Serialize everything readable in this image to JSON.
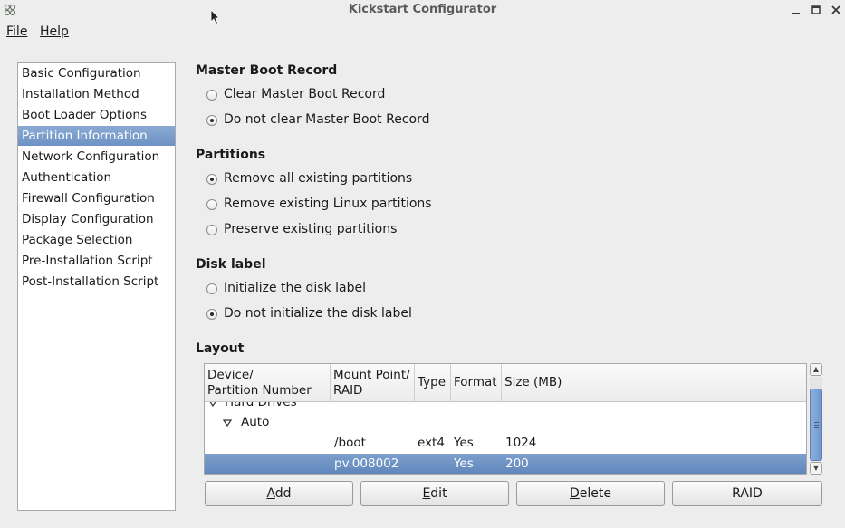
{
  "window": {
    "title": "Kickstart Configurator"
  },
  "menu": {
    "file": "File",
    "help": "Help"
  },
  "sidebar": {
    "items": [
      {
        "label": "Basic Configuration",
        "selected": false
      },
      {
        "label": "Installation Method",
        "selected": false
      },
      {
        "label": "Boot Loader Options",
        "selected": false
      },
      {
        "label": "Partition Information",
        "selected": true
      },
      {
        "label": "Network Configuration",
        "selected": false
      },
      {
        "label": "Authentication",
        "selected": false
      },
      {
        "label": "Firewall Configuration",
        "selected": false
      },
      {
        "label": "Display Configuration",
        "selected": false
      },
      {
        "label": "Package Selection",
        "selected": false
      },
      {
        "label": "Pre-Installation Script",
        "selected": false
      },
      {
        "label": "Post-Installation Script",
        "selected": false
      }
    ]
  },
  "mbr": {
    "title": "Master Boot Record",
    "options": [
      {
        "label": "Clear Master Boot Record",
        "checked": false
      },
      {
        "label": "Do not clear Master Boot Record",
        "checked": true
      }
    ]
  },
  "partitions": {
    "title": "Partitions",
    "options": [
      {
        "label": "Remove all existing partitions",
        "checked": true
      },
      {
        "label": "Remove existing Linux partitions",
        "checked": false
      },
      {
        "label": "Preserve existing partitions",
        "checked": false
      }
    ]
  },
  "disk_label": {
    "title": "Disk label",
    "options": [
      {
        "label": "Initialize the disk label",
        "checked": false
      },
      {
        "label": "Do not initialize the disk label",
        "checked": true
      }
    ]
  },
  "layout": {
    "title": "Layout",
    "columns": {
      "device_1": "Device/",
      "device_2": "Partition Number",
      "mount_1": "Mount Point/",
      "mount_2": "RAID",
      "type": "Type",
      "format": "Format",
      "size": "Size (MB)"
    },
    "rows": {
      "hard_drives": "Hard Drives",
      "auto": "Auto",
      "boot": {
        "mount": "/boot",
        "type": "ext4",
        "format": "Yes",
        "size": "1024"
      },
      "pv": {
        "mount": "pv.008002",
        "type": "",
        "format": "Yes",
        "size": "200"
      }
    }
  },
  "buttons": {
    "add": {
      "mnemonic": "A",
      "rest": "dd"
    },
    "edit": {
      "mnemonic": "E",
      "rest": "dit"
    },
    "delete": {
      "mnemonic": "D",
      "rest": "elete"
    },
    "raid": "RAID"
  }
}
